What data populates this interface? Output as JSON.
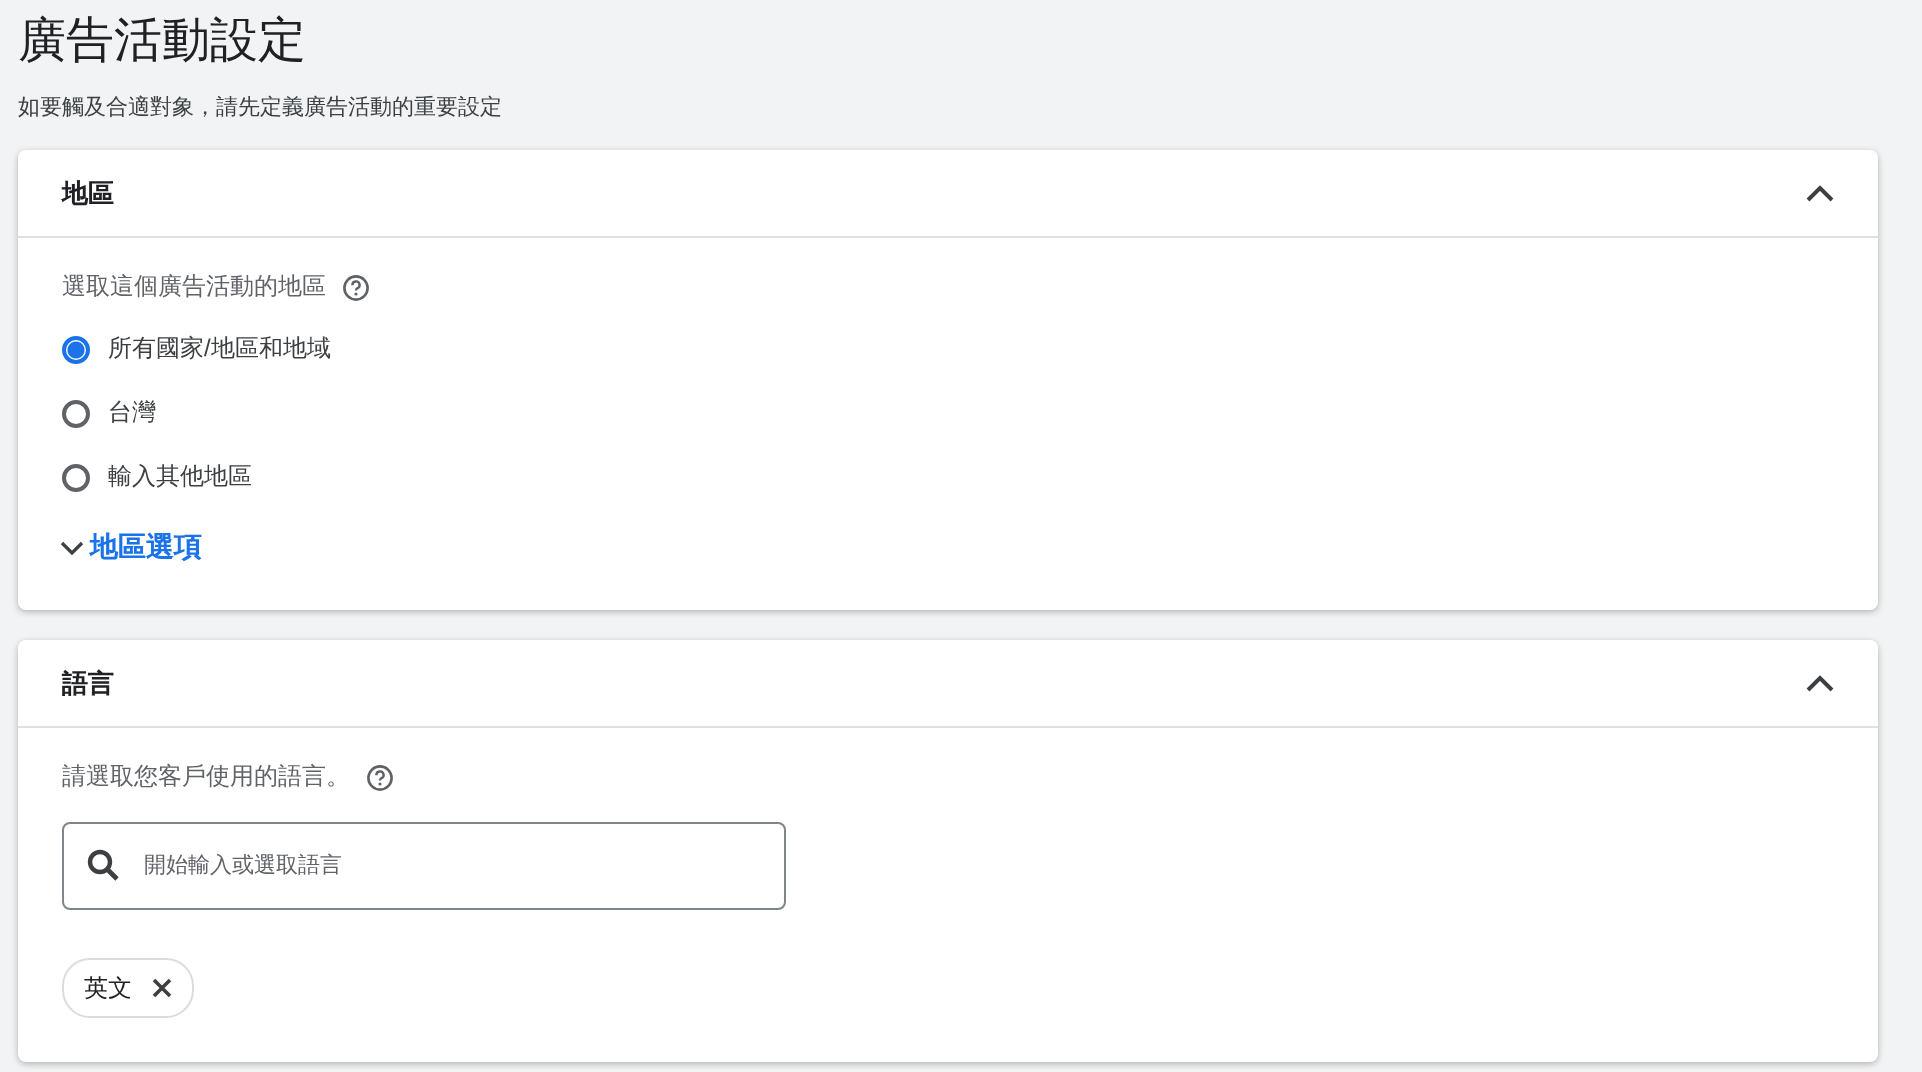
{
  "page": {
    "title": "廣告活動設定",
    "subtitle": "如要觸及合適對象，請先定義廣告活動的重要設定"
  },
  "sections": [
    {
      "kind": "locations",
      "title": "地區",
      "expanded": true,
      "prompt": "選取這個廣告活動的地區",
      "options": [
        {
          "label": "所有國家/地區和地域",
          "selected": true
        },
        {
          "label": "台灣",
          "selected": false
        },
        {
          "label": "輸入其他地區",
          "selected": false
        }
      ],
      "more_link": {
        "label": "地區選項",
        "expanded": false
      }
    },
    {
      "kind": "languages",
      "title": "語言",
      "expanded": true,
      "prompt": "請選取您客戶使用的語言。",
      "search": {
        "placeholder": "開始輸入或選取語言"
      },
      "chips": [
        {
          "label": "英文"
        }
      ]
    }
  ]
}
